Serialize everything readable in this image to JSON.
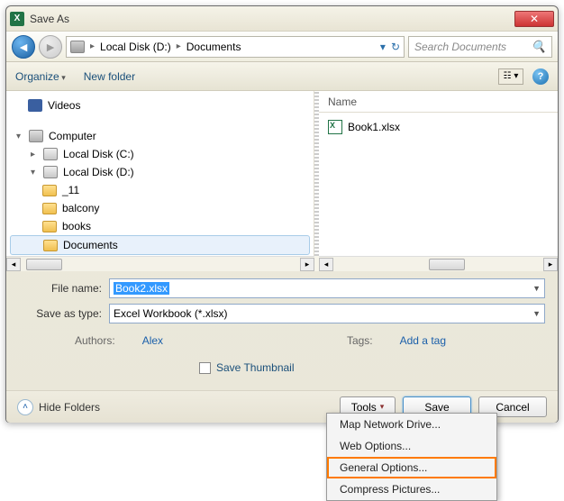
{
  "window": {
    "title": "Save As"
  },
  "addressbar": {
    "crumbs": [
      "Local Disk (D:)",
      "Documents"
    ],
    "search_placeholder": "Search Documents"
  },
  "toolbar": {
    "organize": "Organize",
    "new_folder": "New folder"
  },
  "tree": {
    "videos": "Videos",
    "computer": "Computer",
    "disk_c": "Local Disk (C:)",
    "disk_d": "Local Disk (D:)",
    "folders": [
      "_11",
      "balcony",
      "books",
      "Documents"
    ]
  },
  "filelist": {
    "header_name": "Name",
    "items": [
      "Book1.xlsx"
    ]
  },
  "form": {
    "file_name_label": "File name:",
    "file_name_value": "Book2.xlsx",
    "save_type_label": "Save as type:",
    "save_type_value": "Excel Workbook (*.xlsx)",
    "authors_label": "Authors:",
    "authors_value": "Alex",
    "tags_label": "Tags:",
    "tags_value": "Add a tag",
    "save_thumbnail": "Save Thumbnail"
  },
  "footer": {
    "hide_folders": "Hide Folders",
    "tools": "Tools",
    "save": "Save",
    "cancel": "Cancel"
  },
  "tools_menu": {
    "items": [
      "Map Network Drive...",
      "Web Options...",
      "General Options...",
      "Compress Pictures..."
    ]
  }
}
